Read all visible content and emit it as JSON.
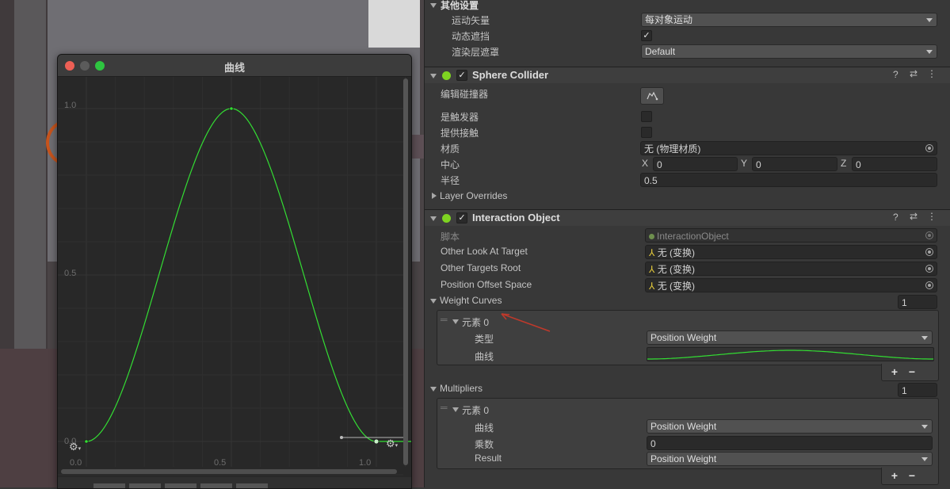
{
  "curve_window": {
    "title": "曲线",
    "y_ticks": [
      "1.0",
      "0.5",
      "0.0"
    ],
    "x_ticks": [
      "0.0",
      "0.5",
      "1.0"
    ]
  },
  "chart_data": {
    "type": "line",
    "xlim": [
      0,
      1.1
    ],
    "ylim": [
      0,
      1.0
    ],
    "grid": true,
    "series": [
      {
        "x": [
          0.0,
          0.1,
          0.2,
          0.3,
          0.4,
          0.5,
          0.6,
          0.7,
          0.8,
          0.9,
          1.0
        ],
        "y": [
          0.0,
          0.1,
          0.35,
          0.65,
          0.9,
          1.0,
          0.9,
          0.65,
          0.35,
          0.1,
          0.0
        ]
      }
    ],
    "keyframes": [
      [
        0.0,
        0.0
      ],
      [
        0.5,
        1.0
      ],
      [
        1.0,
        0.0
      ]
    ]
  },
  "colors": {
    "curve": "#33dd33",
    "accent": "#3aa33a"
  },
  "inspector": {
    "other_settings": {
      "title": "其他设置",
      "motion_vectors": {
        "label": "运动矢量",
        "value": "每对象运动"
      },
      "dynamic_occlusion": {
        "label": "动态遮挡",
        "checked": "✓"
      },
      "rendering_layer_mask": {
        "label": "渲染层遮罩",
        "value": "Default"
      }
    },
    "sphere_collider": {
      "title": "Sphere Collider",
      "checked": "✓",
      "edit_collider": {
        "label": "编辑碰撞器",
        "icon": "edit-collider-icon"
      },
      "is_trigger": {
        "label": "是触发器"
      },
      "provides_contacts": {
        "label": "提供接触"
      },
      "material": {
        "label": "材质",
        "value": "无 (物理材质)"
      },
      "center": {
        "label": "中心",
        "x_label": "X",
        "x": "0",
        "y_label": "Y",
        "y": "0",
        "z_label": "Z",
        "z": "0"
      },
      "radius": {
        "label": "半径",
        "value": "0.5"
      },
      "layer_overrides": {
        "label": "Layer Overrides"
      }
    },
    "interaction_object": {
      "title": "Interaction Object",
      "checked": "✓",
      "script": {
        "label": "脚本",
        "value": "InteractionObject"
      },
      "other_look_at_target": {
        "label": "Other Look At Target",
        "value": "无 (变换)"
      },
      "other_targets_root": {
        "label": "Other Targets Root",
        "value": "无 (变换)"
      },
      "position_offset_space": {
        "label": "Position Offset Space",
        "value": "无 (变换)"
      },
      "weight_curves": {
        "label": "Weight Curves",
        "size": "1",
        "element": {
          "label": "元素 0",
          "type_label": "类型",
          "type_value": "Position Weight",
          "curve_label": "曲线"
        },
        "add": "+",
        "remove": "−"
      },
      "multipliers": {
        "label": "Multipliers",
        "size": "1",
        "element": {
          "label": "元素 0",
          "curve_label": "曲线",
          "curve_value": "Position Weight",
          "multiplier_label": "乘数",
          "multiplier_value": "0",
          "result_label": "Result",
          "result_value": "Position Weight"
        },
        "add": "+",
        "remove": "−"
      }
    }
  }
}
